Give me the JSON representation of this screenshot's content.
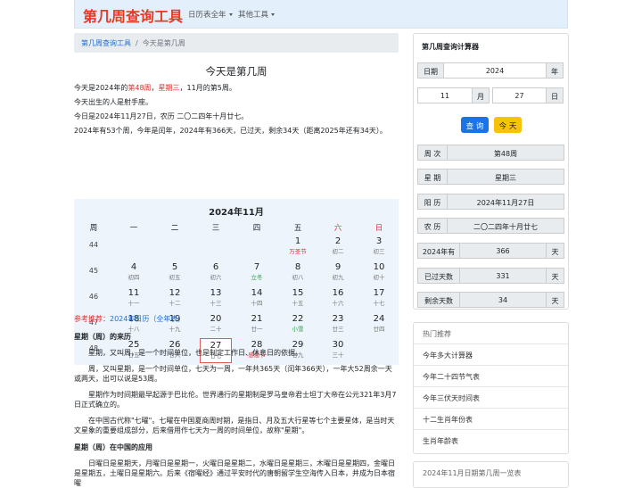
{
  "nav": {
    "brand": "第几周查询工具",
    "items": [
      "日历表全年",
      "其他工具"
    ]
  },
  "breadcrumb": {
    "home": "第几周查询工具",
    "sep": "/",
    "current": "今天是第几周"
  },
  "main": {
    "title": "今天是第几周",
    "line1": {
      "a": "今天是2024年的",
      "week": "第48周",
      "b": "，",
      "weekday": "星期三",
      "c": "，11月的第5周。"
    },
    "line2": "今天出生的人是射手座。",
    "line3": "今日是2024年11月27日，农历 二〇二四年十月廿七。",
    "line4": "2024年有53个周，今年是闰年，2024年有366天，已过天，剩余34天（距离2025年还有34天）。"
  },
  "calendar": {
    "title": "2024年11月",
    "headers": [
      "周",
      "一",
      "二",
      "三",
      "四",
      "五",
      "六",
      "日"
    ],
    "weeks": [
      "44",
      "45",
      "46",
      "47",
      "48"
    ],
    "rows": [
      [
        null,
        null,
        null,
        null,
        {
          "d": "1",
          "l": "万圣节",
          "c": "red"
        },
        {
          "d": "2",
          "l": "初二"
        },
        {
          "d": "3",
          "l": "初三"
        }
      ],
      [
        {
          "d": "4",
          "l": "初四"
        },
        {
          "d": "5",
          "l": "初五"
        },
        {
          "d": "6",
          "l": "初六"
        },
        {
          "d": "7",
          "l": "立冬",
          "c": "green"
        },
        {
          "d": "8",
          "l": "初八"
        },
        {
          "d": "9",
          "l": "初九"
        },
        {
          "d": "10",
          "l": "初十"
        }
      ],
      [
        {
          "d": "11",
          "l": "十一"
        },
        {
          "d": "12",
          "l": "十二"
        },
        {
          "d": "13",
          "l": "十三"
        },
        {
          "d": "14",
          "l": "十四"
        },
        {
          "d": "15",
          "l": "十五"
        },
        {
          "d": "16",
          "l": "十六"
        },
        {
          "d": "17",
          "l": "十七"
        }
      ],
      [
        {
          "d": "18",
          "l": "十八"
        },
        {
          "d": "19",
          "l": "十九"
        },
        {
          "d": "20",
          "l": "二十"
        },
        {
          "d": "21",
          "l": "廿一"
        },
        {
          "d": "22",
          "l": "小雪",
          "c": "green"
        },
        {
          "d": "23",
          "l": "廿三"
        },
        {
          "d": "24",
          "l": "廿四"
        }
      ],
      [
        {
          "d": "25",
          "l": "廿五"
        },
        {
          "d": "26",
          "l": "廿六"
        },
        {
          "d": "27",
          "l": "廿七",
          "today": true
        },
        {
          "d": "28",
          "l": "感恩节",
          "c": "red"
        },
        {
          "d": "29",
          "l": "廿九"
        },
        {
          "d": "30",
          "l": "三十"
        },
        null
      ]
    ],
    "colors": {
      "saturday": "#e03030",
      "sunday": "#e03030",
      "festival": "#e03030",
      "solar_term": "#2e9e45"
    }
  },
  "reference": {
    "label": "参考推荐：",
    "link": "2024年日历（全年表）"
  },
  "article": {
    "h1": "星期（周）的来历",
    "p1": "星期，又叫周，是一个时间单位，也是制定工作日、休息日的依据。",
    "p2": "周，又叫星期，是一个时间单位，七天为一周，一年共365天（闰年366天），一年大52周余一天或两天，出可以说是53周。",
    "p3": "星期作为时间期最早起源于巴比伦。世界通行的星期制是罗马皇帝君士坦丁大帝在公元321年3月7日正式确立的。",
    "p4": "在中国古代称\"七曜\"。七曜在中国夏商周时期，是指日、月及五大行星等七个主要星体，是当时天文星象的重要组成部分，后来借用作七天为一周的时间单位，故称\"星期\"。",
    "h2": "星期（周）在中国的应用",
    "p5": "日曜日是星期天，月曜日是星期一，火曜日是星期二，水曜日是星期三，木曜日是星期四，金曜日是星期五，土曜日是星期六。后来《宿曜经》通过平安时代的唐朝留学生空海传入日本，并成为日本宿曜"
  },
  "calculator": {
    "title": "第几周查询计算器",
    "date_label": "日期",
    "year_value": "2024",
    "year_unit": "年",
    "month_value": "11",
    "month_unit": "月",
    "day_value": "27",
    "day_unit": "日",
    "query_btn": "查 询",
    "today_btn": "今 天",
    "week_label": "周 次",
    "week_value": "第48周",
    "weekday_label": "星 期",
    "weekday_value": "星期三",
    "solar_label": "阳 历",
    "solar_value": "2024年11月27日",
    "lunar_label": "农 历",
    "lunar_value": "二〇二四年十月廿七",
    "year_days_label": "2024年有",
    "year_days_value": "366",
    "day_unit2": "天",
    "passed_label": "已过天数",
    "passed_value": "331",
    "remain_label": "剩余天数",
    "remain_value": "34"
  },
  "hot": {
    "title": "热门推荐",
    "items": [
      "今年多大计算器",
      "今年二十四节气表",
      "今年三伏天时间表",
      "十二生肖年份表",
      "生肖年龄表"
    ]
  },
  "list2": {
    "title": "2024年11月日期第几周一览表"
  }
}
